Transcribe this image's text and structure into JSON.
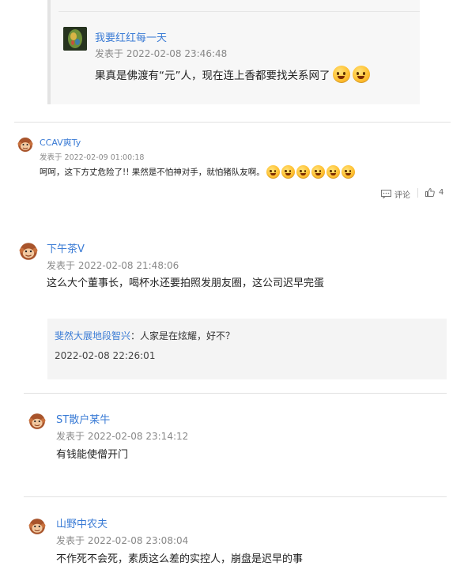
{
  "top_reply": {
    "username": "我要红红每一天",
    "posted": "发表于 2022-02-08 23:46:48",
    "text": "果真是佛渡有“元”人，现在连上香都要找关系网了"
  },
  "comments": [
    {
      "username": "CCAV爽Ty",
      "posted": "发表于 2022-02-09 01:00:18",
      "text": "呵呵，这下方丈危险了!! 果然是不怕神对手，就怕猪队友啊。",
      "actions": {
        "comment_label": "评论",
        "like_count": "4"
      }
    },
    {
      "username": "下午茶V",
      "posted": "发表于 2022-02-08 21:48:06",
      "text": "这么大个董事长，喝杯水还要拍照发朋友圈，这公司迟早完蛋",
      "reply": {
        "user": "斐然大展地段智兴",
        "text": "：人家是在炫耀，好不？",
        "time": "2022-02-08 22:26:01"
      }
    },
    {
      "username": "ST散户某牛",
      "posted": "发表于 2022-02-08 23:14:12",
      "text": "有钱能使僧开门"
    },
    {
      "username": "山野中农夫",
      "posted": "发表于 2022-02-08 23:08:04",
      "text": "不作死不会死，素质这么差的实控人，崩盘是迟早的事"
    }
  ]
}
